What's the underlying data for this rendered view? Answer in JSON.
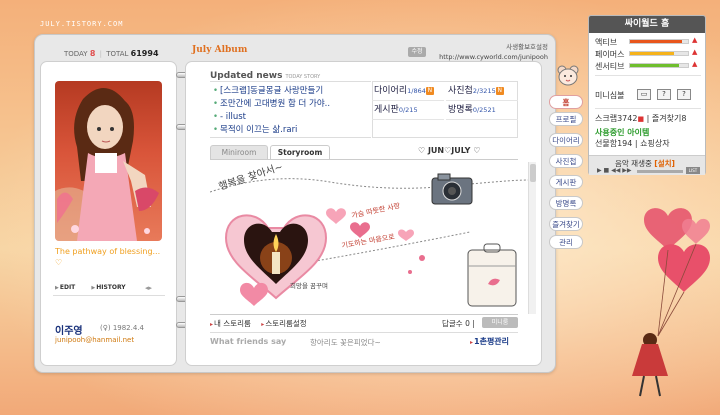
{
  "site_url": "JULY.TISTORY.COM",
  "counter": {
    "today_label": "TODAY",
    "today_value": "8",
    "total_label": "TOTAL",
    "total_value": "61994"
  },
  "profile": {
    "caption": "The pathway of blessing... ♡",
    "edit_label": "EDIT",
    "history_label": "HISTORY",
    "owner_name": "이주영",
    "owner_meta": "(♀) 1982.4.4",
    "owner_email": "junipooh@hanmail.net"
  },
  "header": {
    "album_title": "July Album",
    "edit_badge": "수정",
    "setting_link": "사생활보호설정",
    "homepage_url": "http://www.cyworld.com/junipooh"
  },
  "updated_news": {
    "title": "Updated news",
    "subtitle": "TODAY STORY",
    "items": [
      "[스크랩]동글몽글 사랑만들기",
      "조만간에 고대병원 함 더 가야..",
      "- illust",
      "목적이 이끄는 삶.rari"
    ]
  },
  "stats": [
    {
      "label": "다이어리",
      "count": "1/864",
      "new": true
    },
    {
      "label": "사진첩",
      "count": "2/3215",
      "new": true
    },
    {
      "label": "게시판",
      "count": "0/215",
      "new": false
    },
    {
      "label": "방명록",
      "count": "0/2521",
      "new": false
    }
  ],
  "tabs": {
    "miniroom": "Miniroom",
    "storyroom": "Storyroom",
    "title": "♡ JUN♡JULY ♡"
  },
  "storyroom": {
    "handwriting_1": "행복을 찾아서~",
    "handwriting_2": "가슴 따뜻한 사랑",
    "handwriting_3": "기도하는 마음으로",
    "handwriting_4": "희망을 꿈꾸며",
    "my_story_link": "내 스토리룸",
    "setting_link": "스토리룸설정",
    "reply_label": "답글수",
    "reply_count": "0",
    "reply_button": "미니룸"
  },
  "friends": {
    "title": "What friends say",
    "text": "항아리도 꽃은피었다~",
    "ilchon_link": "1촌평관리"
  },
  "side_menu": [
    "홈",
    "프로필",
    "다이어리",
    "사진첩",
    "게시판",
    "방명록",
    "즐겨찾기",
    "관리"
  ],
  "cy_panel": {
    "title": "싸이월드 홈",
    "bars": [
      {
        "label": "액티브",
        "color": "#e8551b",
        "level": 0.9
      },
      {
        "label": "페이머스",
        "color": "#f5b21a",
        "level": 0.75
      },
      {
        "label": "센서티브",
        "color": "#6fbe2e",
        "level": 0.85
      }
    ],
    "mini_label": "미니심볼",
    "scrap_label": "스크랩",
    "scrap_count": "3742",
    "favorite_label": "즐겨찾기",
    "favorite_count": "8",
    "items_title": "사용중인 아이템",
    "gift_label": "선물함",
    "gift_count": "194",
    "shop_label": "쇼핑상자",
    "music_text": "음악 재생중",
    "music_buy": "[설치]"
  }
}
